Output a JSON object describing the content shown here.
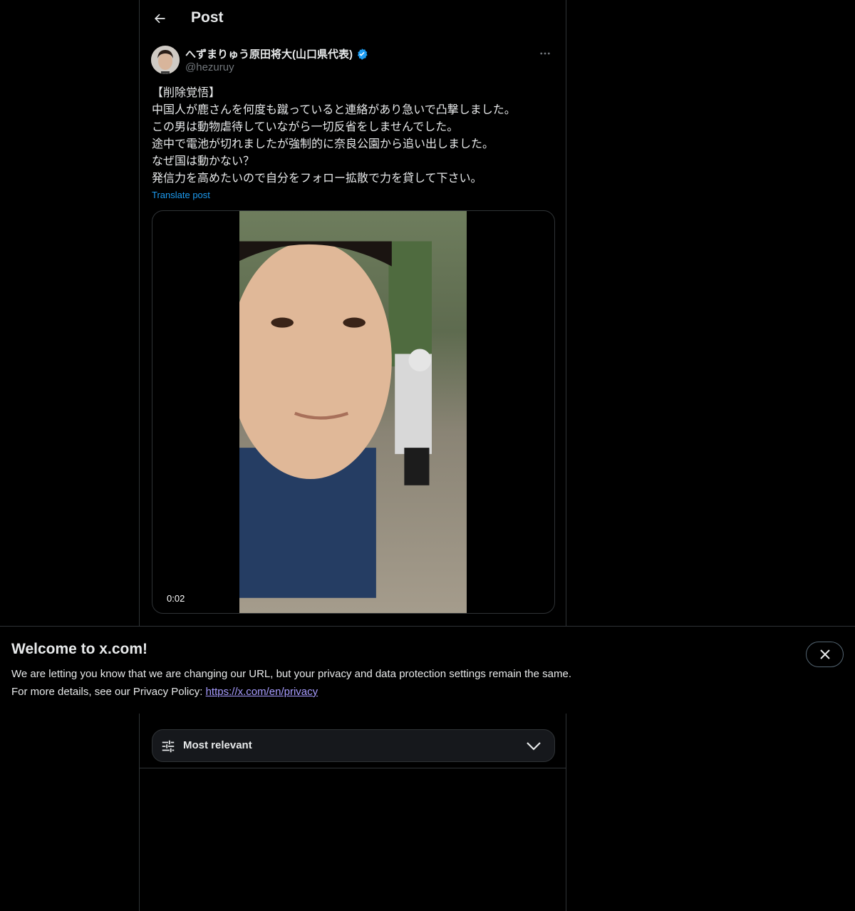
{
  "header": {
    "title": "Post",
    "back_icon": "arrow-left-icon"
  },
  "post": {
    "author": {
      "display_name": "へずまりゅう原田将大(山口県代表)",
      "handle": "@hezuruy",
      "verified": true,
      "verified_color": "#1d9bf0"
    },
    "lines": [
      "【削除覚悟】",
      "中国人が鹿さんを何度も蹴っていると連絡があり急いで凸撃しました。",
      "この男は動物虐待していながら一切反省をしませんでした。",
      "途中で電池が切れましたが強制的に奈良公園から追い出しました。",
      "なぜ国は動かない？",
      "発信力を高めたいので自分をフォロー拡散で力を貸して下さい。"
    ],
    "translate_label": "Translate post",
    "media": {
      "type": "video",
      "timestamp": "0:02"
    }
  },
  "banner": {
    "title": "Welcome to x.com!",
    "line1": "We are letting you know that we are changing our URL, but your privacy and data protection settings remain the same.",
    "line2_prefix": "For more details, see our Privacy Policy: ",
    "link_text": "https://x.com/en/privacy",
    "close_icon": "close-icon"
  },
  "replies": {
    "sort_label": "Most relevant",
    "sort_icon": "sliders-icon",
    "chevron_icon": "chevron-down-icon"
  },
  "colors": {
    "background": "#000000",
    "text": "#e7e9ea",
    "secondary": "#71767b",
    "link": "#1d9bf0",
    "banner_link": "#a79cff"
  }
}
